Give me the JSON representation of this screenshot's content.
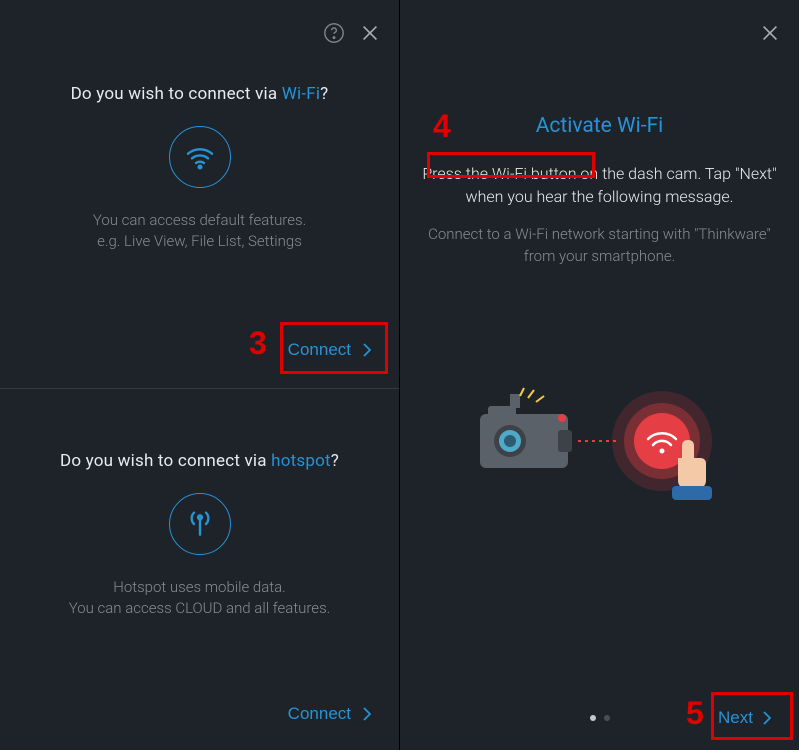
{
  "left": {
    "wifi": {
      "heading_pre": "Do you wish to connect via ",
      "heading_accent": "Wi-Fi",
      "heading_post": "?",
      "desc_line1": "You can access default features.",
      "desc_line2": "e.g. Live View, File List, Settings",
      "connect_label": "Connect"
    },
    "hotspot": {
      "heading_pre": "Do you wish to connect via ",
      "heading_accent": "hotspot",
      "heading_post": "?",
      "desc_line1": "Hotspot uses mobile data.",
      "desc_line2": "You can access CLOUD and all features.",
      "connect_label": "Connect"
    }
  },
  "right": {
    "title": "Activate Wi-Fi",
    "instruction_part1": "Press the Wi-Fi button",
    "instruction_part2": " on the dash cam. Tap \"Next\" when you hear the following message.",
    "sub": "Connect to a Wi-Fi network starting with \"Thinkware\" from your smartphone.",
    "next_label": "Next"
  },
  "annotations": {
    "n3": "3",
    "n4": "4",
    "n5": "5"
  }
}
